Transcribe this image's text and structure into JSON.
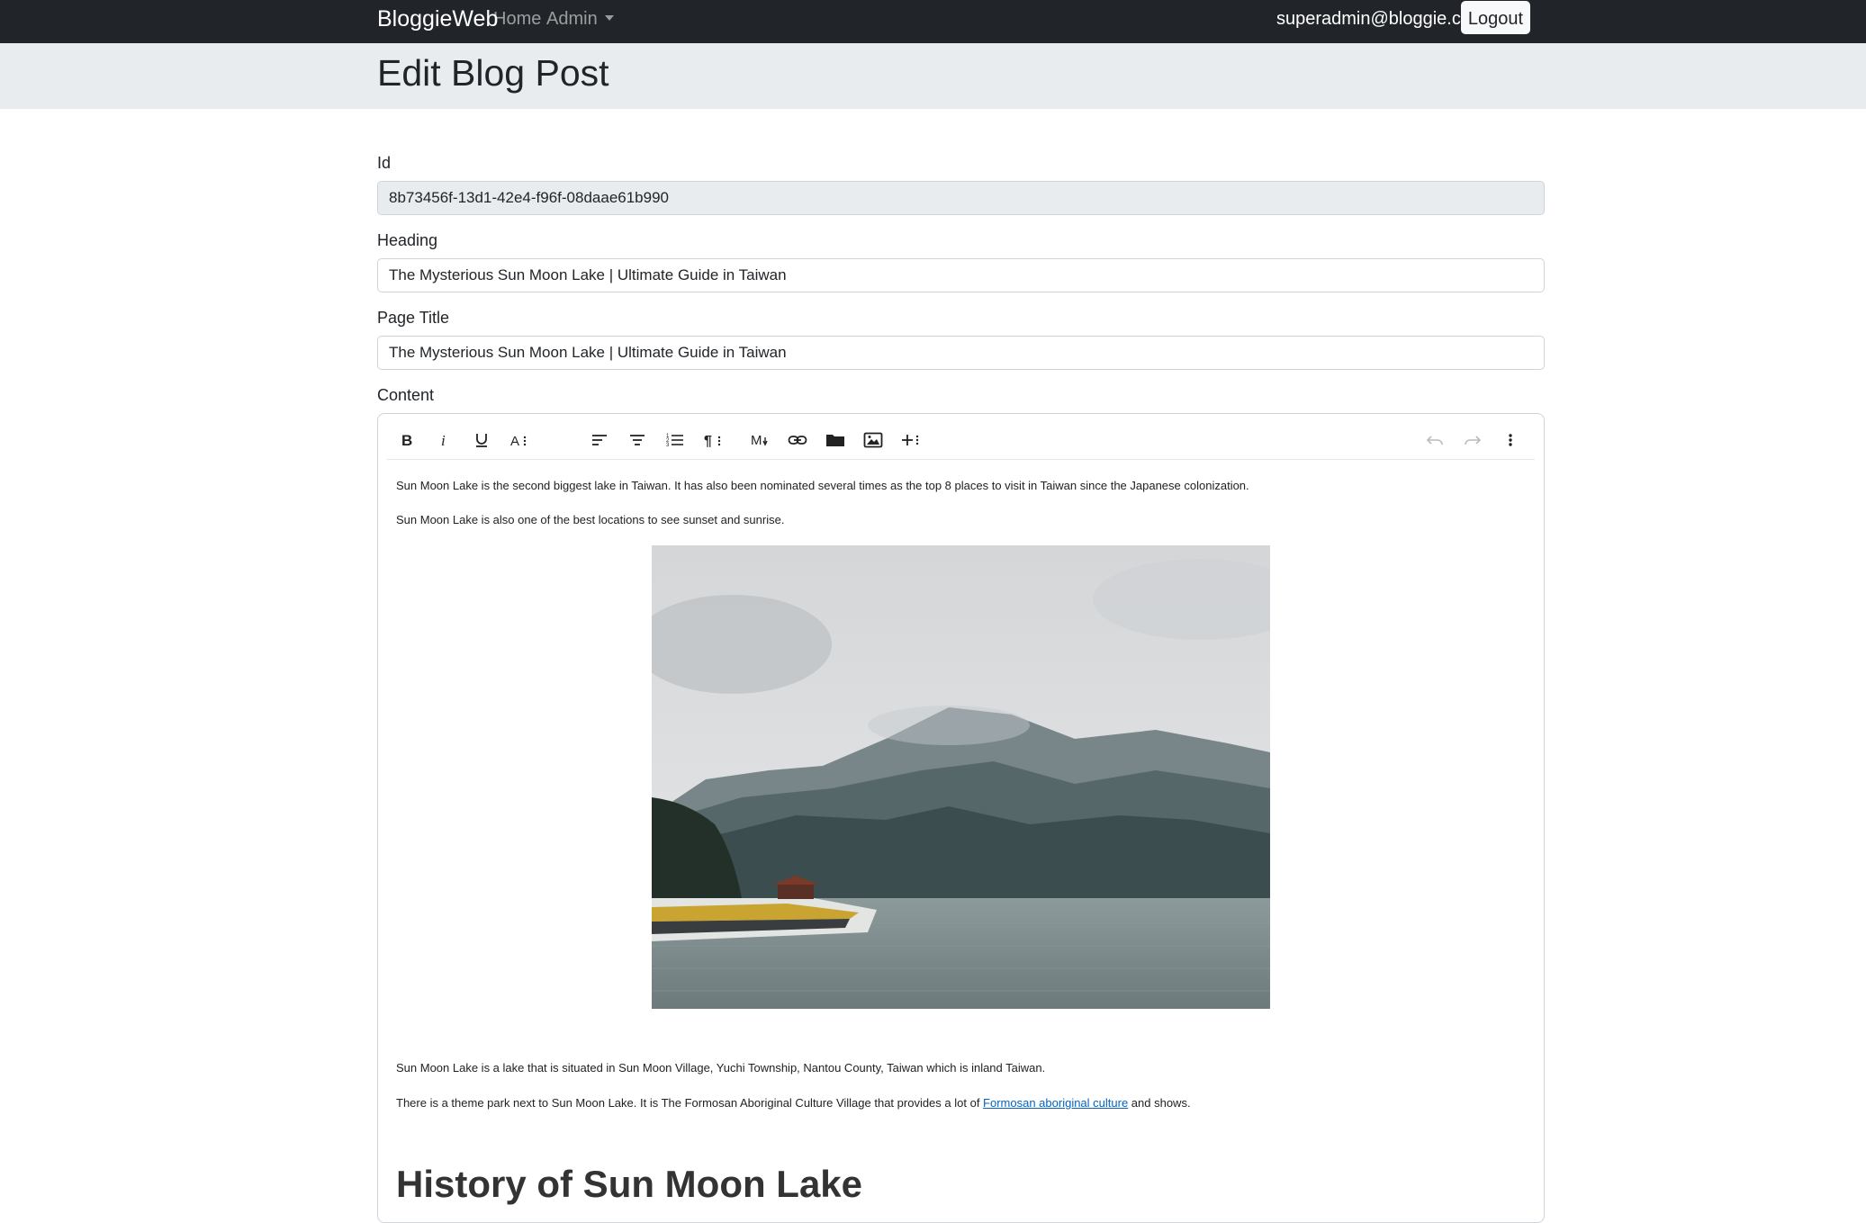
{
  "navbar": {
    "brand": "BloggieWeb",
    "home": "Home",
    "admin": "Admin",
    "user_email": "superadmin@bloggie.com",
    "logout": "Logout"
  },
  "page": {
    "title": "Edit Blog Post"
  },
  "form": {
    "id_label": "Id",
    "id_value": "8b73456f-13d1-42e4-f96f-08daae61b990",
    "heading_label": "Heading",
    "heading_value": "The Mysterious Sun Moon Lake | Ultimate Guide in Taiwan",
    "page_title_label": "Page Title",
    "page_title_value": "The Mysterious Sun Moon Lake | Ultimate Guide in Taiwan",
    "content_label": "Content"
  },
  "toolbar": {
    "icons": [
      "bold-icon",
      "italic-icon",
      "underline-icon",
      "text-size-icon",
      "align-left-icon",
      "align-center-icon",
      "ordered-list-icon",
      "paragraph-icon",
      "markdown-icon",
      "link-icon",
      "folder-icon",
      "image-icon",
      "insert-icon",
      "undo-icon",
      "redo-icon",
      "more-icon"
    ]
  },
  "editor": {
    "p1": "Sun Moon Lake is the second biggest lake in Taiwan. It has also been nominated several times as the top 8 places to visit in Taiwan since the Japanese colonization.",
    "p2": "Sun Moon Lake is also one of the best locations to see sunset and sunrise.",
    "p3": "Sun Moon Lake is a lake that is situated in Sun Moon Village, Yuchi Township, Nantou County, Taiwan which is inland Taiwan.",
    "p4_before": "There is a theme park next to Sun Moon Lake. It is The Formosan Aboriginal Culture Village that provides a lot of ",
    "p4_link": "Formosan aboriginal culture",
    "p4_after": " and shows.",
    "h2": "History of Sun Moon Lake"
  }
}
